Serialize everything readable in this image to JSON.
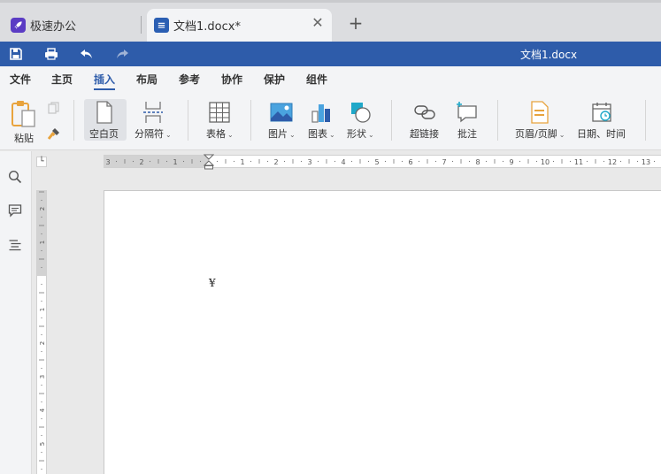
{
  "tabs": {
    "home_label": "极速办公",
    "doc_label": "文档1.docx*",
    "close_symbol": "✕",
    "new_tab_symbol": "+"
  },
  "titlebar": {
    "title": "文档1.docx"
  },
  "menu": {
    "items": [
      "文件",
      "主页",
      "插入",
      "布局",
      "参考",
      "协作",
      "保护",
      "组件"
    ],
    "active": "插入"
  },
  "ribbon": {
    "paste": "粘贴",
    "blank_page": "空白页",
    "page_break": "分隔符",
    "table": "表格",
    "picture": "图片",
    "chart": "图表",
    "shape": "形状",
    "hyperlink": "超链接",
    "comment": "批注",
    "header_footer": "页眉/页脚",
    "date_time": "日期、时间"
  },
  "ruler": {
    "h_numbers": [
      "3",
      "2",
      "1",
      "1",
      "2",
      "3",
      "4",
      "5",
      "6",
      "7",
      "8",
      "9",
      "10",
      "11",
      "12",
      "13"
    ],
    "v_numbers": [
      "2",
      "1",
      "1",
      "2",
      "3",
      "4",
      "5"
    ]
  },
  "document": {
    "mark": "¥"
  },
  "colors": {
    "brand": "#2e5caa",
    "app_icon": "#5b3cc4"
  }
}
